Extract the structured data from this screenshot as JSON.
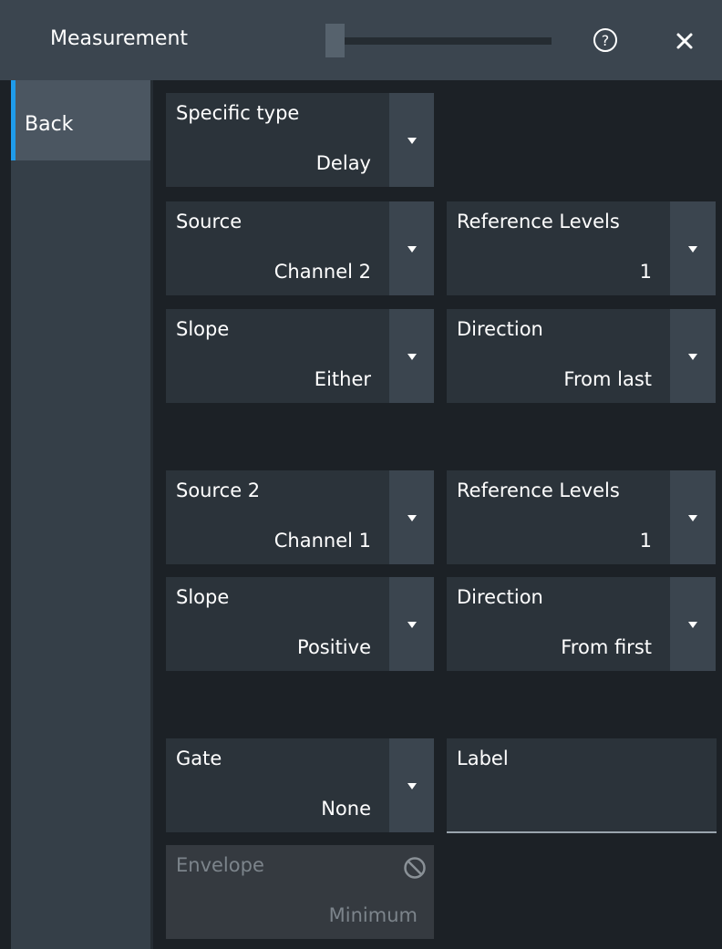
{
  "header": {
    "title": "Measurement",
    "help_icon": "help-circle-icon",
    "close_icon": "close-icon"
  },
  "sidebar": {
    "items": [
      {
        "label": "Back"
      }
    ]
  },
  "panel": {
    "specific_type": {
      "label": "Specific type",
      "value": "Delay"
    },
    "source1": {
      "label": "Source",
      "value": "Channel 2"
    },
    "ref_levels1": {
      "label": "Reference Levels",
      "value": "1"
    },
    "slope1": {
      "label": "Slope",
      "value": "Either"
    },
    "direction1": {
      "label": "Direction",
      "value": "From last"
    },
    "source2": {
      "label": "Source 2",
      "value": "Channel 1"
    },
    "ref_levels2": {
      "label": "Reference Levels",
      "value": "1"
    },
    "slope2": {
      "label": "Slope",
      "value": "Positive"
    },
    "direction2": {
      "label": "Direction",
      "value": "From first"
    },
    "gate": {
      "label": "Gate",
      "value": "None"
    },
    "label_field": {
      "label": "Label",
      "value": ""
    },
    "envelope": {
      "label": "Envelope",
      "value": "Minimum",
      "icon": "no-entry-icon"
    }
  },
  "colors": {
    "accent": "#1f9bea",
    "header_bg": "#3b454f",
    "field_bg": "#2b333a",
    "background": "#1c2126"
  }
}
